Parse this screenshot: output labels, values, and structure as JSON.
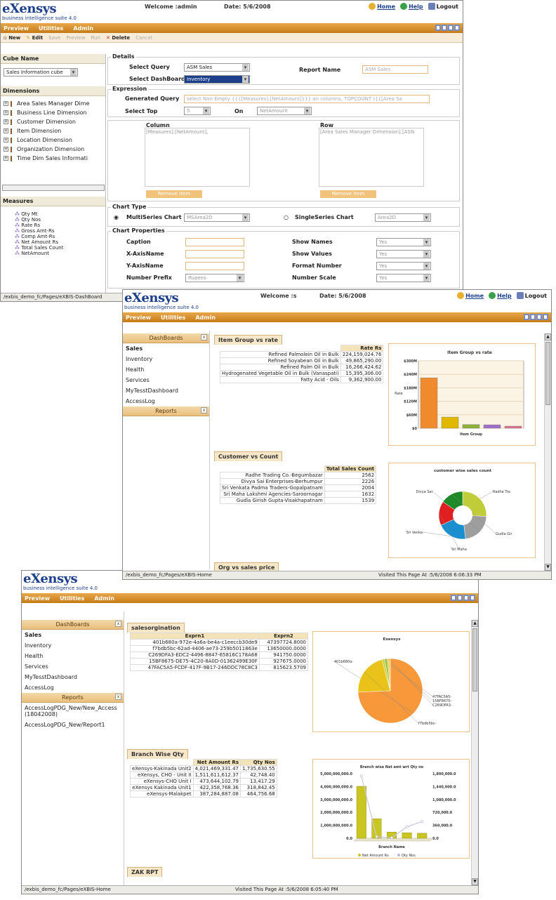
{
  "brand": {
    "name": "eXensys",
    "tagline": "business intelligence suite 4.0"
  },
  "icons": {
    "home": "home-icon",
    "help": "help-icon",
    "logout": "logout-icon"
  },
  "colors": {
    "menubar": "#d98c22",
    "brand": "#1c3f8c",
    "accent_orange": "#f08a2c"
  },
  "w1": {
    "welcome": "Welcome :admin",
    "date": "Date: 5/6/2008",
    "links": {
      "home": "Home",
      "help": "Help",
      "logout": "Logout"
    },
    "menu": [
      "Preview",
      "Utilities",
      "Admin"
    ],
    "toolbar": {
      "new": "New",
      "edit": "Edit",
      "save": "Save",
      "preview": "Preview",
      "run": "Run",
      "delete": "Delete",
      "cancel": "Cancel"
    },
    "cube": {
      "title": "Cube Name",
      "value": "Sales Information cube"
    },
    "dimensions": {
      "title": "Dimensions",
      "items": [
        "Area Sales Manager Dime",
        "Business Line Dimension",
        "Customer Dimension",
        "Item Dimension",
        "Location Dimension",
        "Organization Dimension",
        "Time Dim Sales Informati"
      ]
    },
    "measures": {
      "title": "Measures",
      "items": [
        "Qty Mt",
        "Qty Nos",
        "Rate Rs",
        "Gross Amt-Rs",
        "Comp Amt-Rs",
        "Net Amount Rs",
        "Total Sales Count",
        "NetAmount"
      ]
    },
    "details": {
      "title": "Details",
      "select_query_label": "Select Query",
      "select_query": "ASM Sales",
      "select_dashboard_label": "Select DashBoard",
      "select_dashboard": "Inventory",
      "report_name_label": "Report Name",
      "report_name": "ASM Sales"
    },
    "expression": {
      "title": "Expression",
      "generated_query_label": "Generated Query",
      "generated_query": "select Non Empty  {{{[Measures].[NetAmount]}}} on columns, TOPCOUNT  ({{[Area Sa",
      "select_top_label": "Select Top",
      "select_top": "5",
      "on_label": "On",
      "on_value": "NetAmount"
    },
    "column": {
      "title": "Column",
      "value": "[Measures].[NetAmount],",
      "remove": "Remove Item"
    },
    "row": {
      "title": "Row",
      "value": "[Area Sales Manager Dimension].[ASN",
      "remove": "Remove Item"
    },
    "chart_type": {
      "title": "Chart Type",
      "multi_label": "MultiSeries Chart",
      "multi_value": "MSArea2D",
      "single_label": "SingleSeries Chart",
      "single_value": "Area2D"
    },
    "chart_props": {
      "title": "Chart Properties",
      "caption": "Caption",
      "xaxis": "X-AxisName",
      "yaxis": "Y-AxisName",
      "prefix": "Number Prefix",
      "prefix_value": "Rupees",
      "show_names": "Show Names",
      "show_names_value": "Yes",
      "show_values": "Show Values",
      "show_values_value": "Yes",
      "format_number": "Format Number",
      "format_number_value": "Yes",
      "number_scale": "Number Scale",
      "number_scale_value": "Yes"
    },
    "status": "/exbis_demo_fc/Pages/eXBIS-DashBoard"
  },
  "w2": {
    "welcome": "Welcome :s",
    "date": "Date: 5/6/2008",
    "links": {
      "home": "Home",
      "help": "Help",
      "logout": "Logout"
    },
    "menu": [
      "Preview",
      "Utilities",
      "Admin"
    ],
    "dashboards_title": "DashBoards",
    "dashboards": [
      "Sales",
      "Inventory",
      "Health",
      "Services",
      "MyTesstDashboard",
      "AccessLog"
    ],
    "reports_title": "Reports",
    "p1": {
      "title": "Item Group vs rate",
      "col": "Rate Rs",
      "rows": [
        [
          "Refined Palmolein Oil in Bulk",
          "224,159,024.76"
        ],
        [
          "Refined Soyabean Oil in Bulk",
          "49,865,290.00"
        ],
        [
          "Refined Palm Oil in Bulk",
          "16,266,424.62"
        ],
        [
          "Hydrogenated Vegetable Oil in Bulk (Vanaspati)",
          "15,395,306.00"
        ],
        [
          "Fatty Acid - Oils",
          "9,362,900.00"
        ]
      ]
    },
    "p2": {
      "title": "Customer vs Count",
      "col": "Total Sales Count",
      "rows": [
        [
          "Radhe Trading Co.-Begumbazar",
          "2562"
        ],
        [
          "Divya Sai Enterprises-Berhumpur",
          "2226"
        ],
        [
          "Sri Venkata Padma Traders-Gopalpatnam",
          "2004"
        ],
        [
          "Sri Maha Lakshmi Agencies-Saroornagar",
          "1632"
        ],
        [
          "Gudla Girish Gupta-Visakhapatnam",
          "1539"
        ]
      ]
    },
    "p3": {
      "title": "Org vs sales price"
    },
    "status_left": "/exbis_demo_fc/Pages/eXBIS-Home",
    "status_right": "Visited This Page At :5/6/2008 6:06:33 PM"
  },
  "w3": {
    "menu": [
      "Preview",
      "Utilities",
      "Admin"
    ],
    "dashboards_title": "DashBoards",
    "dashboards": [
      "Sales",
      "Inventory",
      "Health",
      "Services",
      "MyTesstDashboard",
      "AccessLog"
    ],
    "reports_title": "Reports",
    "reports": [
      "AccessLogPDG_New/New_Access (18042008)",
      "AccessLogPDG_New/Report1"
    ],
    "p1": {
      "title": "salesorgination",
      "cols": [
        "Exprn1",
        "Exprn2"
      ],
      "rows": [
        [
          "401b680a-972e-4a6a-be4a-c1eeccb30de9",
          "47397724.8000"
        ],
        [
          "f7bdb5bc-62ad-4406-ae73-259b5011863e",
          "13650000.0000"
        ],
        [
          "C269DFA3-EDC2-4496-8847-65816C178A68",
          "941750.0000"
        ],
        [
          "15BF8675-DE75-4C20-8A0D-01362499E30F",
          "927675.0000"
        ],
        [
          "47FAC5A5-FCDF-417F-9B17-246DDC78C8C3",
          "815623.5709"
        ]
      ]
    },
    "p2": {
      "title": "Branch Wise Qty",
      "cols": [
        "Net Amount Rs",
        "Qty Nos"
      ],
      "rows": [
        [
          "eXensys-Kakinada Unit2",
          "4,021,469,331.47",
          "1,735,630.55"
        ],
        [
          "eXensys, CHO - Unit II",
          "1,511,611,612.37",
          "42,748.40"
        ],
        [
          "eXensys-CHO Unit I",
          "473,644,102.79",
          "13,417.29"
        ],
        [
          "eXensys Kakinada Unit1",
          "422,358,768.36",
          "318,842.45"
        ],
        [
          "eXensys-Malakpet",
          "387,284,887.08",
          "464,756.68"
        ]
      ]
    },
    "p3": {
      "title": "ZAK RPT"
    },
    "status_left": "/exbis_demo_fc/Pages/eXBIS-Home",
    "status_right": "Visited This Page At :5/6/2008 6:05:40 PM"
  },
  "chart_data": [
    {
      "type": "bar",
      "title": "Item Group vs rate",
      "xlabel": "Item Group",
      "ylabel": "Rate",
      "categories": [
        "Refined Palmolein Oil in Bulk",
        "Refined Soyabean Oil in Bulk",
        "Refined Palm Oil in Bulk",
        "Hydrogenated Vegetable Oil in Bulk (Vanaspati)",
        "Fatty Acid - Oils"
      ],
      "values": [
        224159024.76,
        49865290,
        16266424.62,
        15395306,
        9362900
      ],
      "ytick_labels": [
        "$0",
        "$60M",
        "$120M",
        "$180M",
        "$240M",
        "$300M"
      ],
      "ylim": [
        0,
        300000000
      ],
      "colors": [
        "#f08a2c",
        "#e0b800",
        "#8fb13a",
        "#a070c8",
        "#e07090"
      ]
    },
    {
      "type": "pie",
      "title": "customer wise sales count",
      "labels": [
        "Radhe Tra",
        "Divya Sai",
        "Sri Venka",
        "Sri Maha",
        "Gudla Gir"
      ],
      "values": [
        2562,
        2226,
        2004,
        1632,
        1539
      ],
      "colors": [
        "#c0cc38",
        "#9e9e9e",
        "#1a8fcf",
        "#e02020",
        "#1f8a2a"
      ]
    },
    {
      "type": "pie",
      "title": "Exensys",
      "labels": [
        "401b680a-",
        "f7bdb5bc-",
        "47FAC5A5-",
        "15BF8675-",
        "C269DFA3-"
      ],
      "values": [
        47397724.8,
        13650000,
        815623.57,
        927675,
        941750
      ],
      "colors": [
        "#f7983a",
        "#e9c21a",
        "#c9d33f",
        "#9fc34a",
        "#f0d060"
      ]
    },
    {
      "type": "bar",
      "title": "Branch wise Net amt wrt Qty no",
      "xlabel": "Branch Name",
      "categories": [
        "eXensys-Kakinada Unit2",
        "eXensys, CHO - Unit II",
        "eXensys-CHO Unit I",
        "eXensys Kakinada Unit1",
        "eXensys-Malakpet"
      ],
      "series": [
        {
          "name": "Net Amount Rs",
          "values": [
            4021469331.47,
            1511611612.37,
            473644102.79,
            422358768.36,
            387284887.08
          ]
        },
        {
          "name": "Qty Nos",
          "values": [
            1735630.55,
            42748.4,
            13417.29,
            318842.45,
            464756.68
          ]
        }
      ],
      "left_ticks": [
        "0.0",
        "1,000,000,000.0",
        "2,000,000,000.0",
        "3,000,000,000.0",
        "4,000,000,000.0",
        "5,000,000,000.0"
      ],
      "right_ticks": [
        "0.0",
        "360,000.0",
        "720,000.0",
        "1,080,000.0",
        "1,440,000.0",
        "1,800,000.0"
      ],
      "ylim": [
        0,
        5000000000
      ],
      "y2lim": [
        0,
        1800000
      ]
    }
  ]
}
